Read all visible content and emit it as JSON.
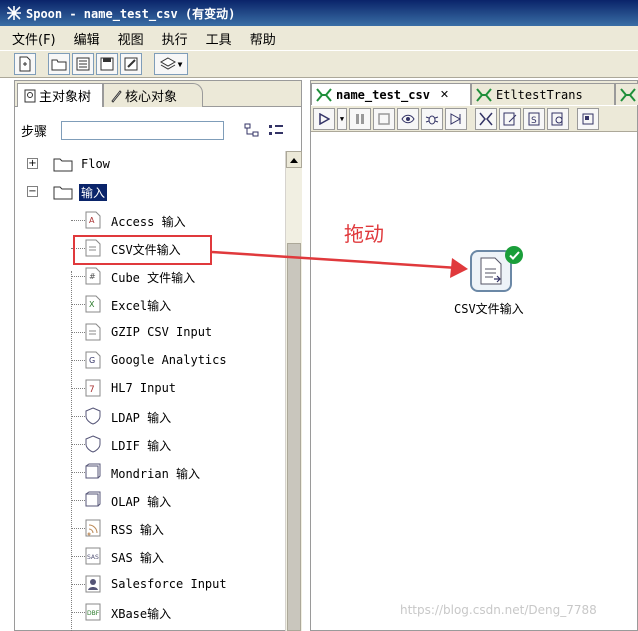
{
  "window": {
    "title": "Spoon - name_test_csv (有变动)"
  },
  "menu": [
    "文件(F)",
    "编辑",
    "视图",
    "执行",
    "工具",
    "帮助"
  ],
  "left_tabs": {
    "main_tree": "主对象树",
    "core_objects": "核心对象"
  },
  "steps_search": {
    "label": "步骤",
    "value": ""
  },
  "tree": {
    "flow_label": "Flow",
    "input_label": "输入",
    "items": [
      "Access 输入",
      "CSV文件输入",
      "Cube 文件输入",
      "Excel输入",
      "GZIP CSV Input",
      "Google Analytics",
      "HL7 Input",
      "LDAP 输入",
      "LDIF 输入",
      "Mondrian 输入",
      "OLAP 输入",
      "RSS 输入",
      "SAS 输入",
      "Salesforce Input",
      "XBase输入"
    ]
  },
  "editor_tabs": [
    "name_test_csv",
    "EtltestTrans"
  ],
  "canvas": {
    "drag_annotation": "拖动",
    "step_label": "CSV文件输入"
  },
  "watermark": "https://blog.csdn.net/Deng_7788",
  "colors": {
    "annotation_red": "#e0393c",
    "selection_blue": "#0a246a",
    "check_green": "#1a9e3a"
  }
}
